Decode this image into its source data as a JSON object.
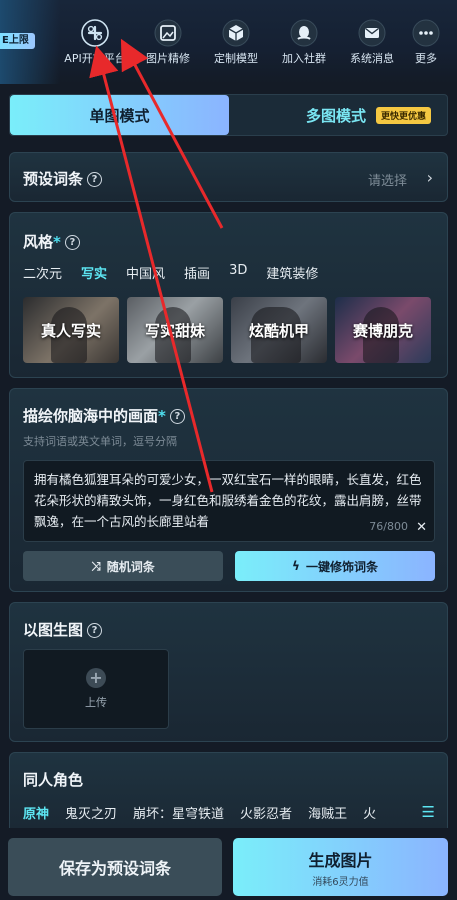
{
  "topbar": {
    "badge": "E上限",
    "nav": [
      {
        "label": "API开放平台",
        "icon": "api-icon"
      },
      {
        "label": "图片精修",
        "icon": "image-refine-icon"
      },
      {
        "label": "定制模型",
        "icon": "cube-icon"
      },
      {
        "label": "加入社群",
        "icon": "community-icon"
      },
      {
        "label": "系统消息",
        "icon": "mail-icon"
      },
      {
        "label": "更多",
        "icon": "more-icon"
      }
    ]
  },
  "mode": {
    "single": "单图模式",
    "multi": "多图模式",
    "multi_badge": "更快更优惠"
  },
  "preset": {
    "title": "预设词条",
    "select_placeholder": "请选择"
  },
  "style": {
    "title": "风格",
    "tabs": [
      "二次元",
      "写实",
      "中国风",
      "插画",
      "3D",
      "建筑装修"
    ],
    "active_tab": "写实",
    "cards": [
      "真人写实",
      "写实甜妹",
      "炫酷机甲",
      "赛博朋克"
    ]
  },
  "describe": {
    "title": "描绘你脑海中的画面",
    "subtitle": "支持词语或英文单词，逗号分隔",
    "prompt": "拥有橘色狐狸耳朵的可爱少女，一双红宝石一样的眼睛，长直发，红色花朵形状的精致头饰，一身红色和服绣着金色的花纹，露出肩膀，丝带飘逸，在一个古风的长廊里站着",
    "count": "76/800",
    "random_btn": "随机词条",
    "polish_btn": "一键修饰词条"
  },
  "img2img": {
    "title": "以图生图",
    "upload_label": "上传"
  },
  "fan": {
    "title": "同人角色",
    "tabs": [
      "原神",
      "鬼灭之刃",
      "崩坏：星穹铁道",
      "火影忍者",
      "海贼王",
      "火"
    ],
    "active_tab": "原神"
  },
  "bottom": {
    "save_btn": "保存为预设词条",
    "generate_btn": "生成图片",
    "generate_sub": "消耗6灵力值"
  },
  "colors": {
    "accent_cyan": "#5de6f3",
    "gradient_start": "#7aeefa",
    "gradient_end": "#8bb4ff",
    "annotation_red": "#e8292b"
  }
}
